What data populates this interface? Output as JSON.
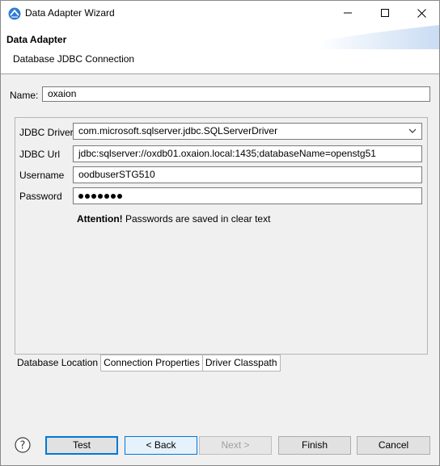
{
  "window": {
    "title": "Data Adapter Wizard",
    "minimize_icon": "minimize-icon",
    "maximize_icon": "maximize-icon",
    "close_icon": "close-icon"
  },
  "banner": {
    "title": "Data Adapter",
    "subtitle": "Database JDBC Connection"
  },
  "name": {
    "label": "Name:",
    "value": "oxaion"
  },
  "form": {
    "driver_label": "JDBC Driver",
    "driver_value": "com.microsoft.sqlserver.jdbc.SQLServerDriver",
    "url_label": "JDBC Url",
    "url_value": "jdbc:sqlserver://oxdb01.oxaion.local:1435;databaseName=openstg51",
    "username_label": "Username",
    "username_value": "oodbuserSTG510",
    "password_label": "Password",
    "password_length": 7,
    "attention_bold": "Attention!",
    "attention_text": "Passwords are saved in clear text"
  },
  "tabs": [
    {
      "label": "Database Location",
      "active": true
    },
    {
      "label": "Connection Properties",
      "active": false
    },
    {
      "label": "Driver Classpath",
      "active": false
    }
  ],
  "buttons": {
    "help_icon": "help-icon",
    "test": "Test",
    "back": "< Back",
    "next": "Next >",
    "finish": "Finish",
    "cancel": "Cancel"
  },
  "colors": {
    "accent": "#0078d7",
    "background": "#f0f0f0"
  }
}
